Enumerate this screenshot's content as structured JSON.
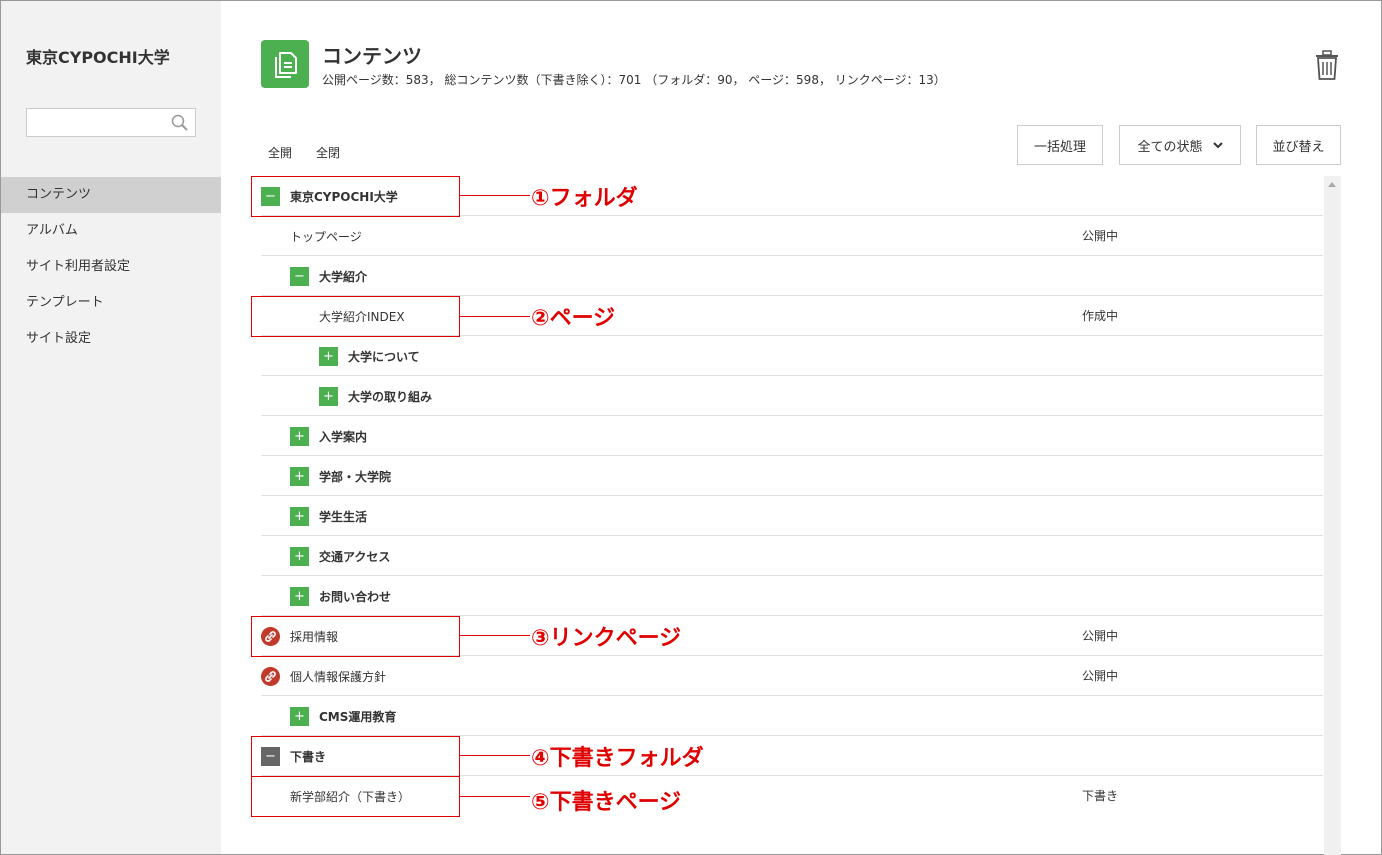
{
  "sidebar": {
    "site_title": "東京CYPOCHI大学",
    "search_placeholder": "",
    "items": [
      {
        "label": "コンテンツ",
        "active": true
      },
      {
        "label": "アルバム"
      },
      {
        "label": "サイト利用者設定"
      },
      {
        "label": "テンプレート"
      },
      {
        "label": "サイト設定"
      }
    ]
  },
  "header": {
    "title": "コンテンツ",
    "stats": "公開ページ数：583， 総コンテンツ数（下書き除く）：701 （フォルダ：90， ページ：598， リンクページ：13）"
  },
  "toolbar": {
    "expand_all": "全開",
    "collapse_all": "全閉",
    "bulk_label": "一括処理",
    "status_label": "全ての状態",
    "sort_label": "並び替え"
  },
  "tree": {
    "rows": [
      {
        "label": "東京CYPOCHI大学",
        "type": "folder",
        "toggle": "−",
        "status": ""
      },
      {
        "label": "トップページ",
        "type": "page",
        "status": "公開中"
      },
      {
        "label": "大学紹介",
        "type": "folder",
        "toggle": "−",
        "status": ""
      },
      {
        "label": "大学紹介INDEX",
        "type": "page",
        "status": "作成中"
      },
      {
        "label": "大学について",
        "type": "folder",
        "toggle": "+",
        "status": ""
      },
      {
        "label": "大学の取り組み",
        "type": "folder",
        "toggle": "+",
        "status": ""
      },
      {
        "label": "入学案内",
        "type": "folder",
        "toggle": "+",
        "status": ""
      },
      {
        "label": "学部・大学院",
        "type": "folder",
        "toggle": "+",
        "status": ""
      },
      {
        "label": "学生生活",
        "type": "folder",
        "toggle": "+",
        "status": ""
      },
      {
        "label": "交通アクセス",
        "type": "folder",
        "toggle": "+",
        "status": ""
      },
      {
        "label": "お問い合わせ",
        "type": "folder",
        "toggle": "+",
        "status": ""
      },
      {
        "label": "採用情報",
        "type": "link",
        "status": "公開中"
      },
      {
        "label": "個人情報保護方針",
        "type": "link",
        "status": "公開中"
      },
      {
        "label": "CMS運用教育",
        "type": "folder",
        "toggle": "+",
        "status": ""
      },
      {
        "label": "下書き",
        "type": "draft-folder",
        "toggle": "−",
        "status": ""
      },
      {
        "label": "新学部紹介（下書き）",
        "type": "page",
        "status": "下書き"
      }
    ]
  },
  "annotations": [
    {
      "label": "①フォルダ"
    },
    {
      "label": "②ページ"
    },
    {
      "label": "③リンクページ"
    },
    {
      "label": "④下書きフォルダ"
    },
    {
      "label": "⑤下書きページ"
    }
  ],
  "colors": {
    "accent_green": "#4caf50",
    "annotation_red": "#e00000",
    "link_red": "#c0392b",
    "draft_gray": "#666666"
  }
}
